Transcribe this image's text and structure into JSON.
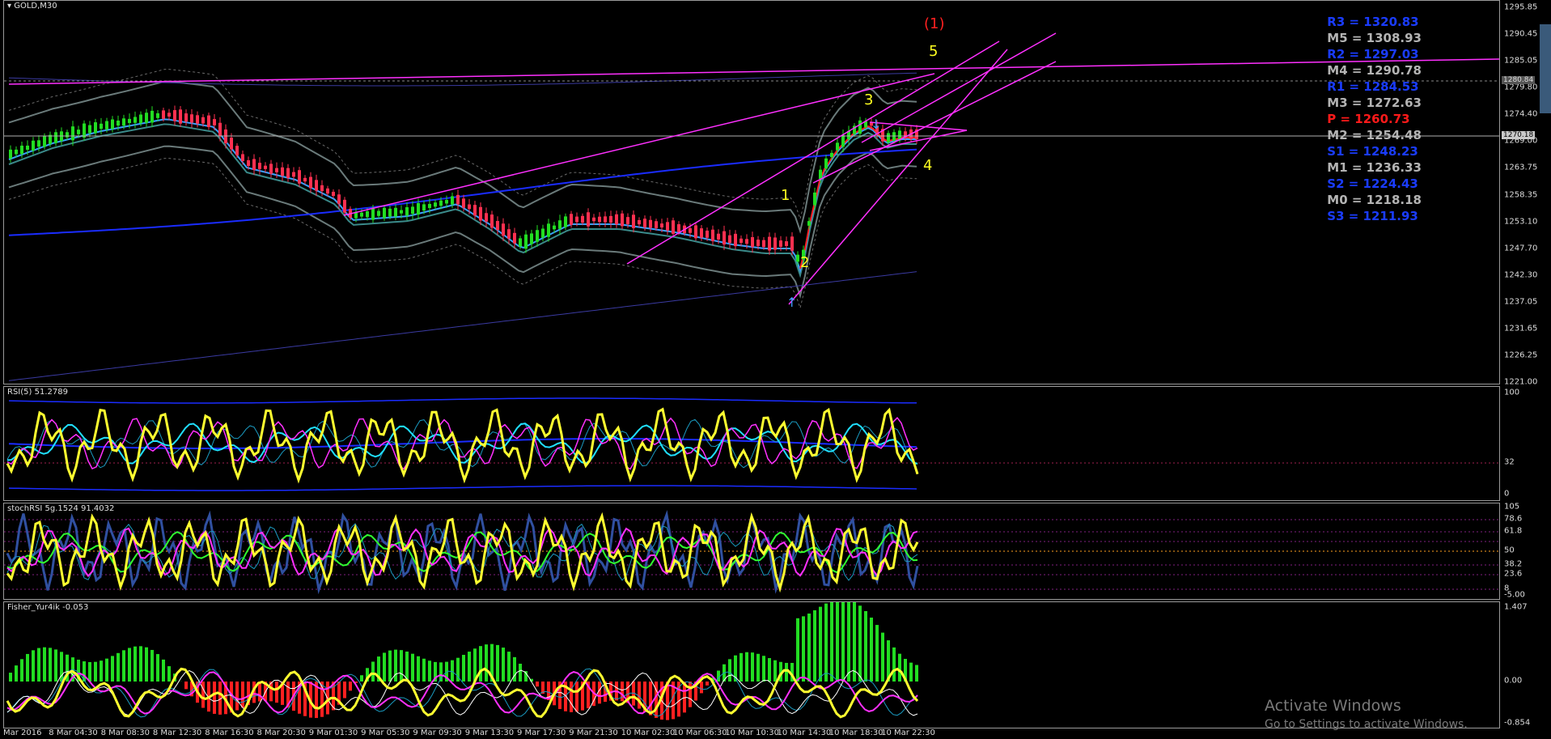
{
  "main": {
    "title": "GOLD,M30",
    "price_ticks": [
      "1295.85",
      "1290.45",
      "1285.05",
      "1279.80",
      "1274.40",
      "1269.00",
      "1263.75",
      "1258.35",
      "1253.10",
      "1247.70",
      "1242.30",
      "1237.05",
      "1231.65",
      "1226.25",
      "1221.00"
    ],
    "current_price_tag": "1270.18",
    "line_tag": "1280.84",
    "waves": [
      "(1)",
      "5",
      "3",
      "4",
      "1",
      "2"
    ],
    "pivots": [
      {
        "label": "R3 = 1320.83",
        "color": "#1a3cff"
      },
      {
        "label": "M5 = 1308.93",
        "color": "#b4b4b4"
      },
      {
        "label": "R2 = 1297.03",
        "color": "#1a3cff"
      },
      {
        "label": "M4 = 1290.78",
        "color": "#b4b4b4"
      },
      {
        "label": "R1 = 1284.53",
        "color": "#1a3cff"
      },
      {
        "label": "M3 = 1272.63",
        "color": "#b4b4b4"
      },
      {
        "label": "P  = 1260.73",
        "color": "#ff1a1a"
      },
      {
        "label": "M2 = 1254.48",
        "color": "#b4b4b4"
      },
      {
        "label": "S1 = 1248.23",
        "color": "#1a3cff"
      },
      {
        "label": "M1 = 1236.33",
        "color": "#b4b4b4"
      },
      {
        "label": "S2 = 1224.43",
        "color": "#1a3cff"
      },
      {
        "label": "M0 = 1218.18",
        "color": "#b4b4b4"
      },
      {
        "label": "S3 = 1211.93",
        "color": "#1a3cff"
      }
    ]
  },
  "rsi": {
    "title": "RSI(5) 51.2789",
    "ticks": [
      "100",
      "32",
      "0"
    ]
  },
  "stoch": {
    "title": "stochRSI 5g.1524 91.4032",
    "ticks": [
      "105",
      "78.6",
      "61.8",
      "50",
      "38.2",
      "23.6",
      "8",
      "-5.00"
    ]
  },
  "fisher": {
    "title": "Fisher_Yur4ik -0.053",
    "ticks": [
      "1.407",
      "0.00",
      "-0.854"
    ]
  },
  "time_axis": [
    "Mar 2016",
    "8 Mar 04:30",
    "8 Mar 08:30",
    "8 Mar 12:30",
    "8 Mar 16:30",
    "8 Mar 20:30",
    "9 Mar 01:30",
    "9 Mar 05:30",
    "9 Mar 09:30",
    "9 Mar 13:30",
    "9 Mar 17:30",
    "9 Mar 21:30",
    "10 Mar 02:30",
    "10 Mar 06:30",
    "10 Mar 10:30",
    "10 Mar 14:30",
    "10 Mar 18:30",
    "10 Mar 22:30"
  ],
  "watermark": {
    "line1": "Activate Windows",
    "line2": "Go to Settings to activate Windows."
  },
  "colors": {
    "bull": "#22dd22",
    "bear": "#ff3050",
    "fast": "#ffff30",
    "magenta": "#ff30ff",
    "cyan": "#20e0ff",
    "blue": "#1a2cff",
    "teal": "#3a8a8a"
  }
}
